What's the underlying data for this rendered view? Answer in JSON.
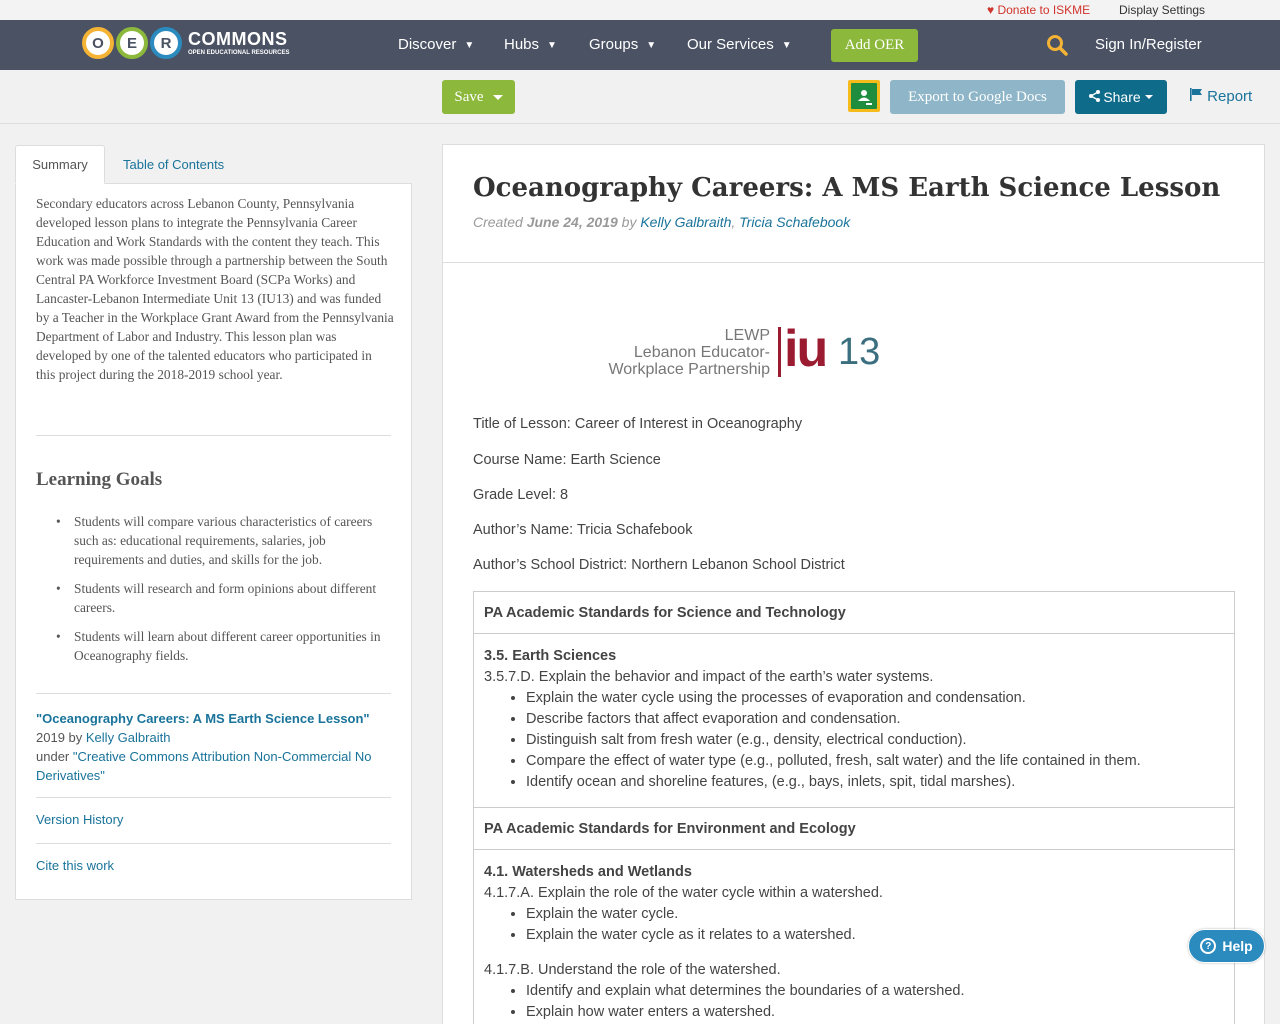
{
  "utility": {
    "donate": "Donate to ISKME",
    "display_settings": "Display Settings"
  },
  "nav": {
    "logo_letters": [
      "O",
      "E",
      "R"
    ],
    "logo_main": "COMMONS",
    "logo_sub": "OPEN EDUCATIONAL RESOURCES",
    "items": [
      {
        "label": "Discover"
      },
      {
        "label": "Hubs"
      },
      {
        "label": "Groups"
      },
      {
        "label": "Our Services"
      }
    ],
    "add_oer": "Add OER",
    "sign_in": "Sign In/Register"
  },
  "toolbar": {
    "save": "Save",
    "export": "Export to Google Docs",
    "share": "Share",
    "report": "Report"
  },
  "sidebar": {
    "tabs": [
      "Summary",
      "Table of Contents"
    ],
    "summary": "Secondary educators across Lebanon County, Pennsylvania developed lesson plans to integrate the Pennsylvania Career Education and Work Standards with the content they teach. This work was made possible through a partnership between the South Central PA Workforce Investment Board (SCPa Works) and Lancaster-Lebanon Intermediate Unit 13 (IU13) and was funded by a Teacher in the Workplace Grant Award from the Pennsylvania Department of Labor and Industry. This lesson plan was developed by one of the talented educators who participated in this project during the 2018-2019 school year.",
    "learning_goals_title": "Learning Goals",
    "goals": [
      "Students will compare various characteristics of careers such as: educational requirements, salaries, job requirements and duties, and skills for the job.",
      "Students will research and form opinions about different careers.",
      "Students will learn about different career opportunities in Oceanography fields."
    ],
    "attribution": {
      "title": "\"Oceanography Careers: A MS Earth Science Lesson\"",
      "year_by": "2019 by",
      "author": "Kelly Galbraith",
      "under": "under",
      "license": "\"Creative Commons Attribution Non-Commercial No Derivatives\""
    },
    "version_history": "Version History",
    "cite": "Cite this work"
  },
  "main": {
    "title": "Oceanography Careers: A MS Earth Science Lesson",
    "created_label": "Created",
    "created_date": "June 24, 2019",
    "by": "by",
    "author1": "Kelly Galbraith",
    "sep": ",",
    "author2": "Tricia Schafebook",
    "banner": {
      "line1": "LEWP",
      "line2": "Lebanon Educator-",
      "line3": "Workplace Partnership",
      "iu": "iu",
      "num": "13"
    },
    "meta": [
      "Title of Lesson: Career of Interest in Oceanography",
      "Course Name: Earth Science",
      "Grade Level: 8",
      "Author’s Name: Tricia Schafebook",
      "Author’s School District: Northern Lebanon School District"
    ],
    "standards": [
      {
        "header": "PA Academic Standards for Science and Technology",
        "sub": "3.5. Earth Sciences",
        "groups": [
          {
            "lead": "3.5.7.D.  Explain the behavior and impact of the earth’s water systems.",
            "items": [
              "Explain the water cycle using the processes of evaporation and condensation.",
              "Describe factors that affect evaporation and condensation.",
              "Distinguish salt from fresh water (e.g., density, electrical conduction).",
              "Compare the effect of water type (e.g., polluted, fresh, salt water) and the life contained in them.",
              "Identify ocean and shoreline features, (e.g., bays, inlets, spit, tidal marshes)."
            ]
          }
        ]
      },
      {
        "header": "PA Academic Standards for Environment and Ecology",
        "sub": "4.1.  Watersheds and Wetlands",
        "groups": [
          {
            "lead": "4.1.7.A.  Explain the role of the water cycle within a watershed.",
            "items": [
              "Explain the water cycle.",
              "Explain the water cycle as it relates to a watershed."
            ]
          },
          {
            "lead": "4.1.7.B.  Understand the role of the watershed.",
            "items": [
              "Identify and explain what determines the boundaries of a watershed.",
              "Explain how water enters a watershed."
            ]
          }
        ]
      }
    ]
  },
  "help": "Help",
  "colors": {
    "nav_bg": "#4a5263",
    "green": "#8cb83c",
    "link": "#19739a",
    "share": "#0f6b8a",
    "donate": "#d0342c"
  }
}
